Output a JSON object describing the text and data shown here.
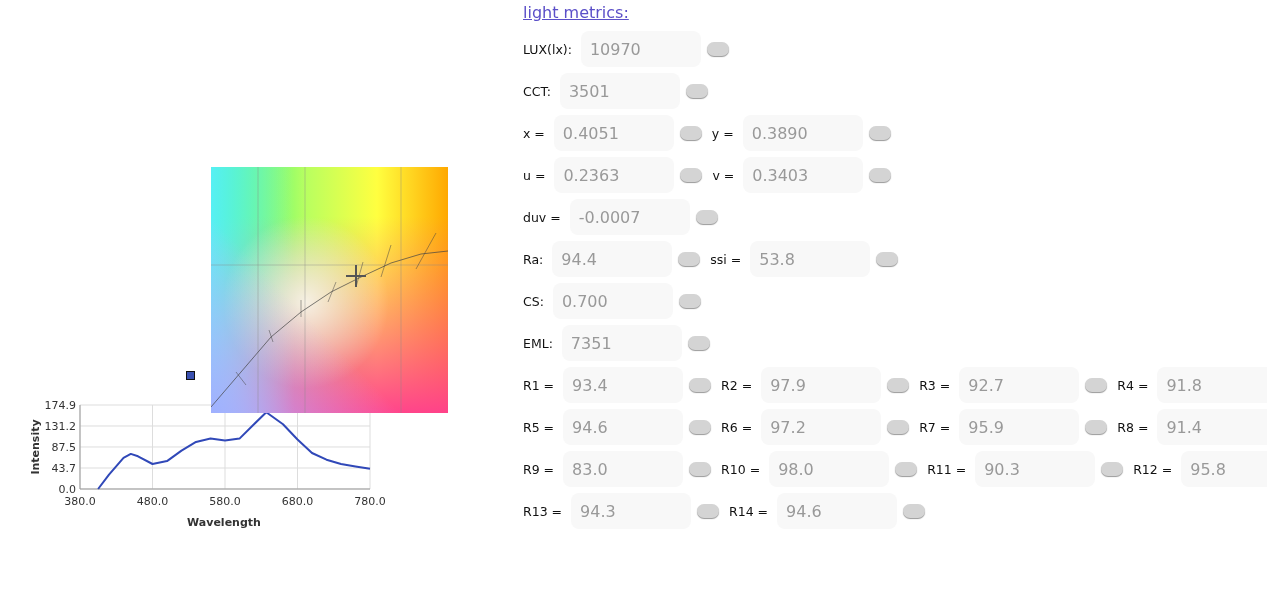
{
  "spectrum": {
    "chart_data": {
      "type": "line",
      "xlabel": "Wavelength",
      "ylabel": "Intensity",
      "x": [
        405,
        420,
        440,
        450,
        460,
        480,
        500,
        520,
        540,
        560,
        580,
        600,
        620,
        637,
        660,
        680,
        700,
        720,
        740,
        760,
        780
      ],
      "grid": true,
      "series": [
        {
          "color": "#3048b8",
          "values": [
            0,
            30,
            65,
            73,
            68,
            52,
            58,
            80,
            98,
            105,
            101,
            105,
            135,
            160,
            135,
            103,
            75,
            61,
            52,
            47,
            42
          ]
        }
      ],
      "xlim": [
        380,
        780
      ],
      "ylim": [
        0,
        174.9
      ],
      "xticks": [
        {
          "value": 380,
          "label": "380.0"
        },
        {
          "value": 480,
          "label": "480.0"
        },
        {
          "value": 580,
          "label": "580.0"
        },
        {
          "value": 680,
          "label": "680.0"
        },
        {
          "value": 780,
          "label": "780.0"
        }
      ],
      "yticks": [
        {
          "value": 0,
          "label": "0.0"
        },
        {
          "value": 43.7,
          "label": "43.7"
        },
        {
          "value": 87.5,
          "label": "87.5"
        },
        {
          "value": 131.2,
          "label": "131.2"
        },
        {
          "value": 174.9,
          "label": "174.9"
        }
      ]
    }
  },
  "metrics": {
    "title": "light metrics:",
    "rows": [
      [
        {
          "label": "LUX(lx):",
          "value": "10970"
        }
      ],
      [
        {
          "label": "CCT:",
          "value": "3501"
        }
      ],
      [
        {
          "label": "x =",
          "value": "0.4051"
        },
        {
          "label": "y =",
          "value": "0.3890"
        }
      ],
      [
        {
          "label": "u =",
          "value": "0.2363"
        },
        {
          "label": "v =",
          "value": "0.3403"
        }
      ],
      [
        {
          "label": "duv =",
          "value": "-0.0007"
        }
      ],
      [
        {
          "label": "Ra:",
          "value": "94.4"
        },
        {
          "label": "ssi =",
          "value": "53.8"
        }
      ],
      [
        {
          "label": "CS:",
          "value": "0.700"
        }
      ],
      [
        {
          "label": "EML:",
          "value": "7351"
        }
      ],
      [
        {
          "label": "R1 =",
          "value": "93.4"
        },
        {
          "label": "R2 =",
          "value": "97.9"
        },
        {
          "label": "R3 =",
          "value": "92.7"
        },
        {
          "label": "R4 =",
          "value": "91.8"
        }
      ],
      [
        {
          "label": "R5 =",
          "value": "94.6"
        },
        {
          "label": "R6 =",
          "value": "97.2"
        },
        {
          "label": "R7 =",
          "value": "95.9"
        },
        {
          "label": "R8 =",
          "value": "91.4"
        }
      ],
      [
        {
          "label": "R9 =",
          "value": "83.0"
        },
        {
          "label": "R10 =",
          "value": "98.0"
        },
        {
          "label": "R11 =",
          "value": "90.3"
        },
        {
          "label": "R12 =",
          "value": "95.8"
        }
      ],
      [
        {
          "label": "R13 =",
          "value": "94.3"
        },
        {
          "label": "R14 =",
          "value": "94.6"
        }
      ]
    ]
  }
}
